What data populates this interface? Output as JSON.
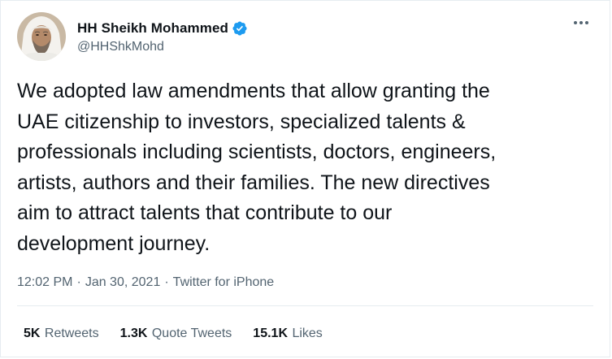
{
  "author": {
    "display_name": "HH Sheikh Mohammed",
    "handle": "@HHShkMohd",
    "verified": true,
    "avatar_icon": "avatar-photo"
  },
  "tweet": {
    "lines": [
      "We adopted law amendments that allow granting the",
      "UAE citizenship to investors, specialized talents &",
      "professionals including scientists, doctors, engineers,",
      "artists, authors and their families. The new directives",
      "aim to attract talents that contribute to our",
      "development journey."
    ]
  },
  "meta": {
    "time": "12:02 PM",
    "date": "Jan 30, 2021",
    "separator": "·",
    "source": "Twitter for iPhone"
  },
  "stats": {
    "retweets_count": "5K",
    "retweets_label": "Retweets",
    "quotes_count": "1.3K",
    "quotes_label": "Quote Tweets",
    "likes_count": "15.1K",
    "likes_label": "Likes"
  },
  "colors": {
    "text_primary": "#0f1419",
    "text_secondary": "#536471",
    "verified_blue": "#1d9bf0",
    "divider": "#e6ecf0"
  }
}
